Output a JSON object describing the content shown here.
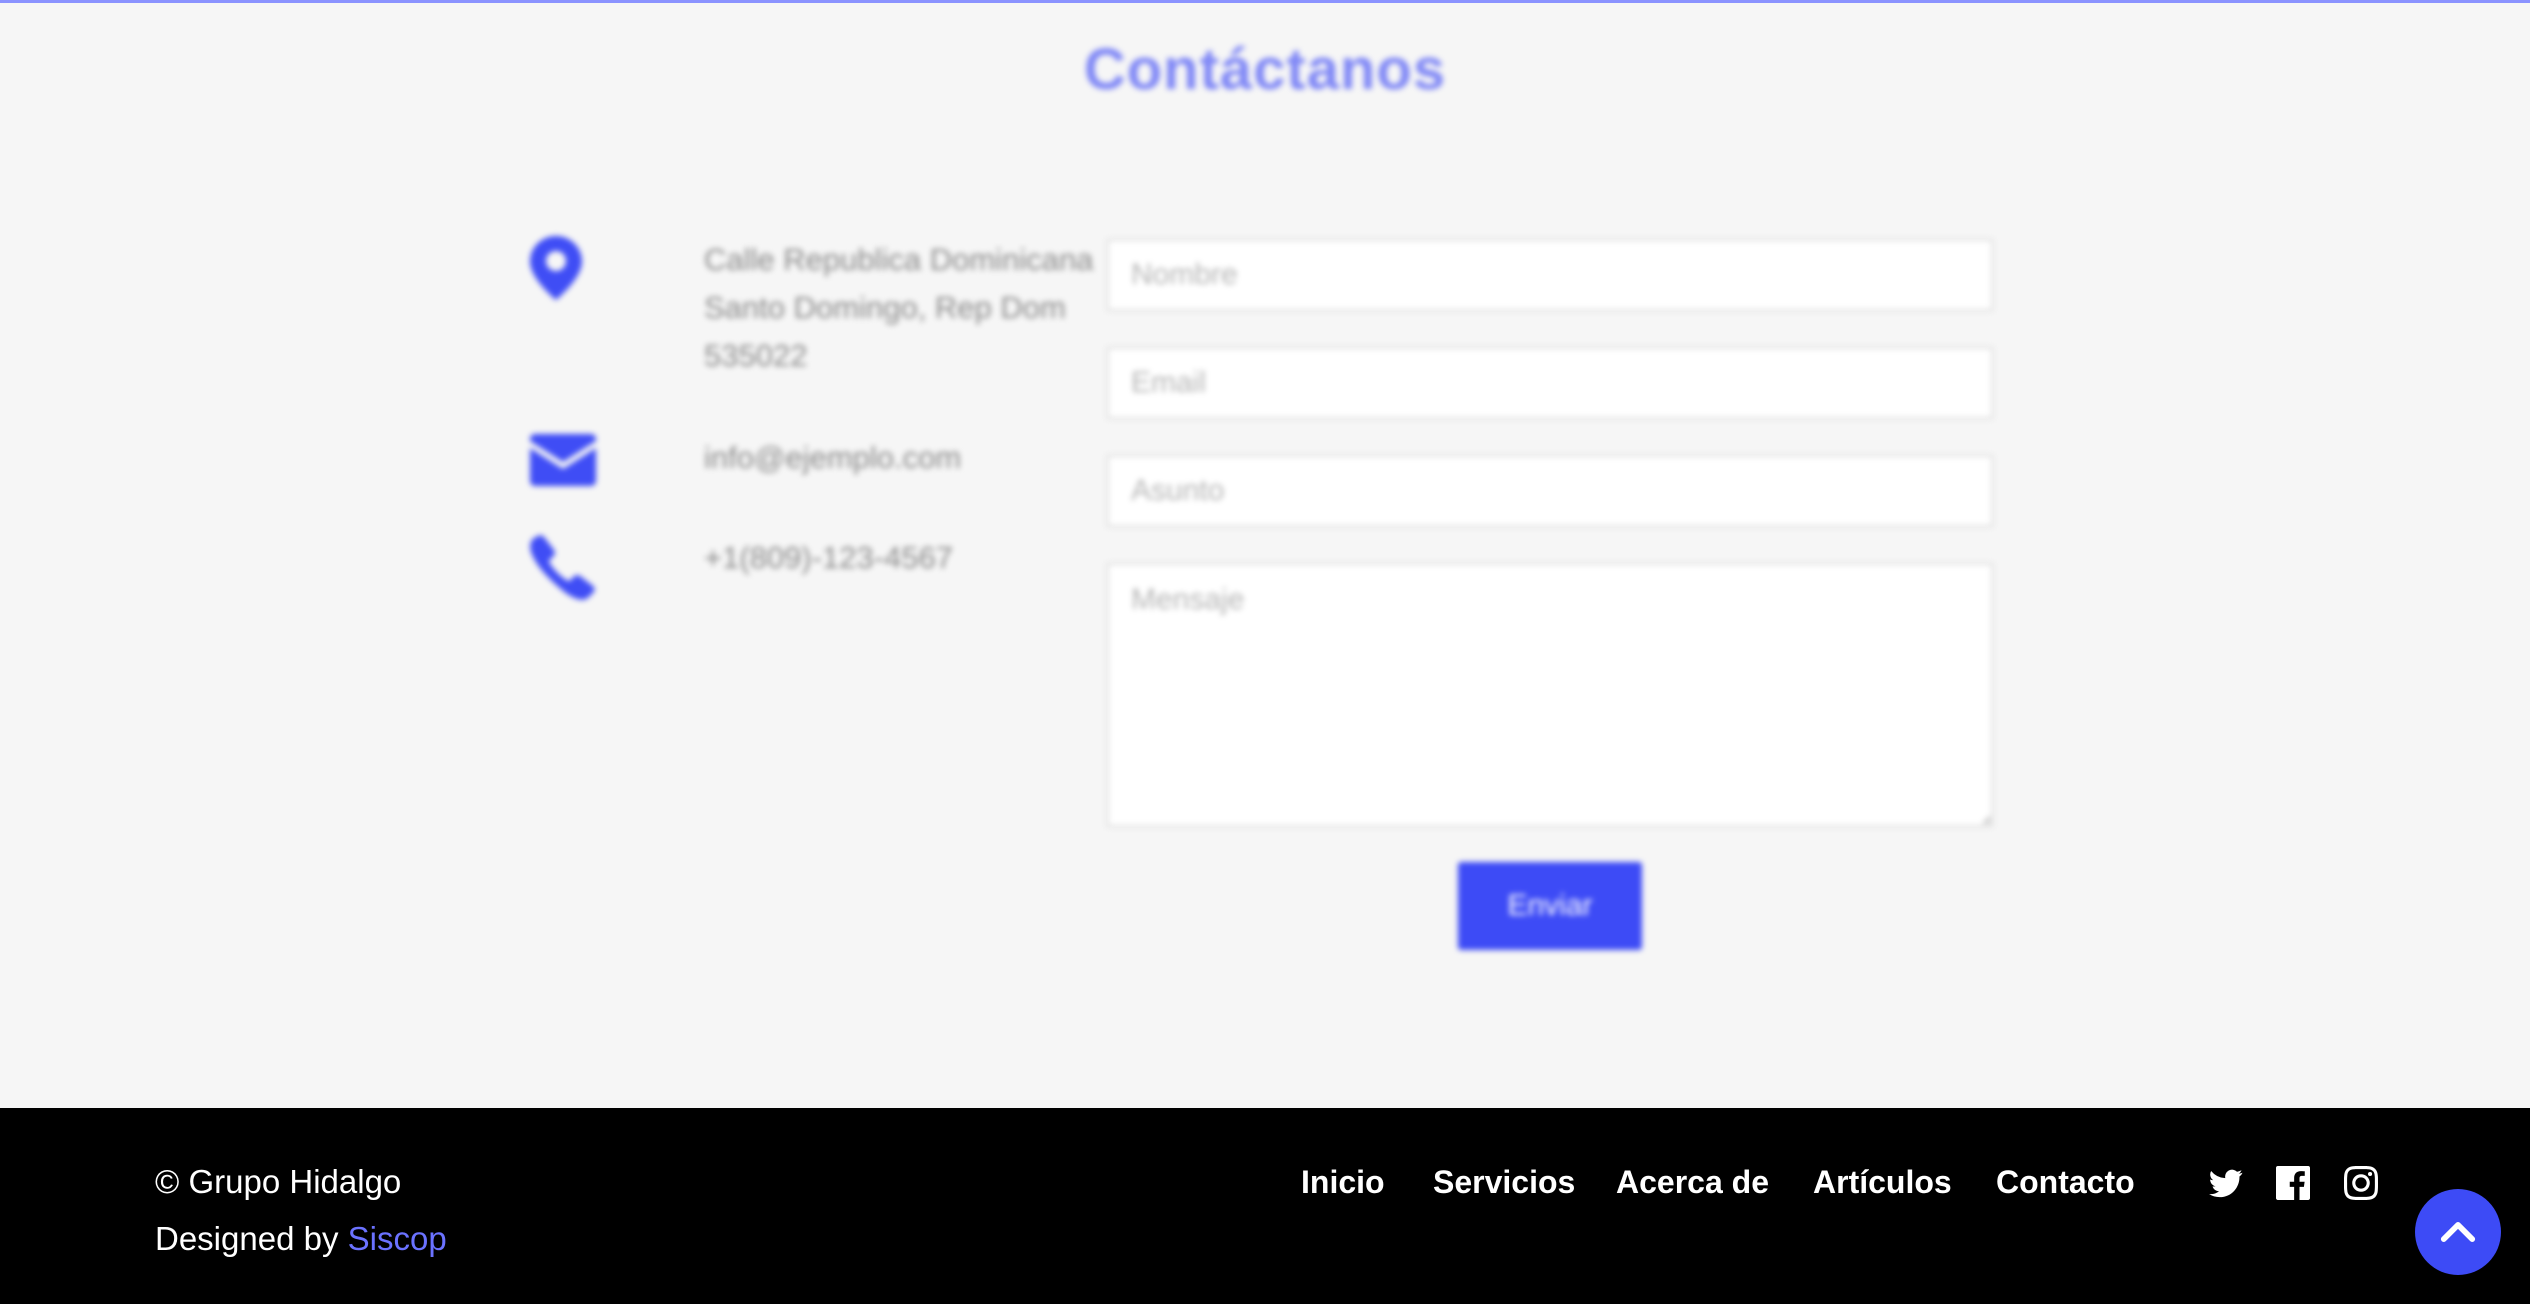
{
  "contact": {
    "title": "Contáctanos",
    "address": "Calle Republica Dominicana Santo Domingo, Rep Dom 535022",
    "email": "info@ejemplo.com",
    "phone": "+1(809)-123-4567",
    "form": {
      "name_placeholder": "Nombre",
      "email_placeholder": "Email",
      "subject_placeholder": "Asunto",
      "message_placeholder": "Mensaje",
      "submit_label": "Enviar"
    },
    "icons": [
      "map-pin-icon",
      "envelope-icon",
      "phone-icon"
    ]
  },
  "footer": {
    "copyright": "© Grupo Hidalgo",
    "designed_prefix": "Designed by ",
    "designed_link": "Siscop",
    "nav": [
      "Inicio",
      "Servicios",
      "Acerca de",
      "Artículos",
      "Contacto"
    ],
    "social_icons": [
      "twitter-icon",
      "facebook-icon",
      "instagram-icon"
    ],
    "back_to_top_icon": "chevron-up-icon"
  },
  "colors": {
    "accent": "#3d4bf6",
    "link": "#6b72ff",
    "title": "#7e86f6",
    "footer_bg": "#000000",
    "page_bg": "#f6f6f6"
  }
}
